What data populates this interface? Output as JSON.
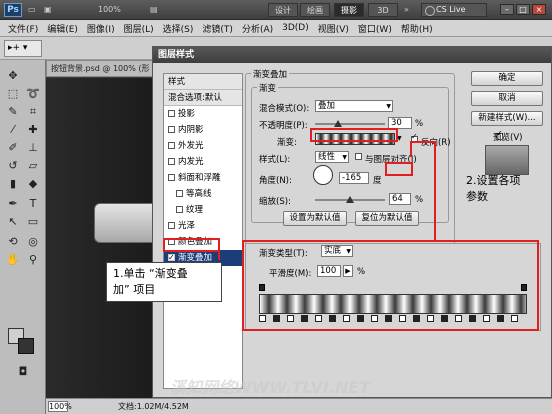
{
  "app": {
    "logo": "Ps",
    "zoom_display": "100%",
    "workspaces": [
      "设计",
      "绘画",
      "摄影",
      "3D"
    ],
    "active_workspace": "摄影",
    "more": "»",
    "cslive": "CS Live"
  },
  "menu": [
    "文件(F)",
    "编辑(E)",
    "图像(I)",
    "图层(L)",
    "选择(S)",
    "滤镜(T)",
    "分析(A)",
    "3D(D)",
    "视图(V)",
    "窗口(W)",
    "帮助(H)"
  ],
  "document": {
    "tab": "按钮背景.psd @ 100% (形",
    "zoom": "100%",
    "doc_size": "文档:1.02M/4.52M"
  },
  "dialog": {
    "title": "图层样式",
    "styles_header": "样式",
    "blend_options": "混合选项:默认",
    "styles": [
      {
        "label": "投影",
        "checked": false
      },
      {
        "label": "内阴影",
        "checked": false
      },
      {
        "label": "外发光",
        "checked": false
      },
      {
        "label": "内发光",
        "checked": false
      },
      {
        "label": "斜面和浮雕",
        "checked": false
      },
      {
        "label": "等高线",
        "checked": false,
        "sub": true
      },
      {
        "label": "纹理",
        "checked": false,
        "sub": true
      },
      {
        "label": "光泽",
        "checked": false
      },
      {
        "label": "颜色叠加",
        "checked": false
      },
      {
        "label": "渐变叠加",
        "checked": true,
        "selected": true
      }
    ],
    "section_title": "渐变叠加",
    "group_title": "渐变",
    "blend_mode_label": "混合模式(O):",
    "blend_mode": "叠加",
    "opacity_label": "不透明度(P):",
    "opacity": "30",
    "percent": "%",
    "gradient_label": "渐变:",
    "reverse_label": "反向(R)",
    "reverse_checked": true,
    "style_label": "样式(L):",
    "style_value": "线性",
    "align_label": "与图层对齐(I)",
    "align_checked": false,
    "angle_label": "角度(N):",
    "angle": "-165",
    "degree": "度",
    "scale_label": "缩放(S):",
    "scale": "64",
    "btn_default": "设置为默认值",
    "btn_reset": "复位为默认值",
    "ok": "确定",
    "cancel": "取消",
    "new_style": "新建样式(W)...",
    "preview": "预览(V)",
    "preview_checked": true
  },
  "gradient_editor": {
    "type_label": "渐变类型(T):",
    "type_value": "实底",
    "smooth_label": "平滑度(M):",
    "smooth_value": "100",
    "percent": "%"
  },
  "annotations": {
    "step1": "1.单击 “渐变叠\n加” 项目",
    "step2": "2.设置各项\n参数"
  },
  "watermark": "溪知网络WWW.TLVI.NET",
  "colors": {
    "accent_red": "#e02020",
    "selection": "#1b3d78"
  }
}
